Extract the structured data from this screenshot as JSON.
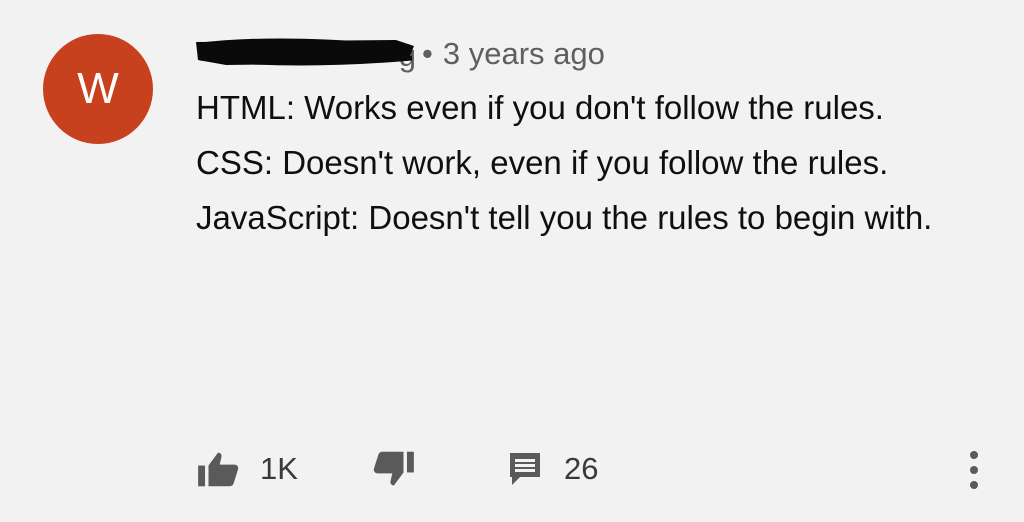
{
  "comment": {
    "avatar_letter": "W",
    "author_visible_fragment": "g",
    "separator": "•",
    "time": "3 years ago",
    "lines": [
      "HTML: Works even if you don't follow the rules.",
      "CSS: Doesn't work, even if you follow the rules.",
      "JavaScript: Doesn't tell you the rules to begin with."
    ]
  },
  "actions": {
    "like_icon": "thumb-up-icon",
    "like_count": "1K",
    "dislike_icon": "thumb-down-icon",
    "reply_icon": "comment-icon",
    "reply_count": "26",
    "more_icon": "more-vertical-icon"
  },
  "colors": {
    "background": "#f2f2f2",
    "avatar": "#c8411e",
    "text": "#0f0f0f",
    "secondary_text": "#5f5f5f",
    "icon": "#5a5a5a",
    "redaction": "#0a0a0a"
  }
}
